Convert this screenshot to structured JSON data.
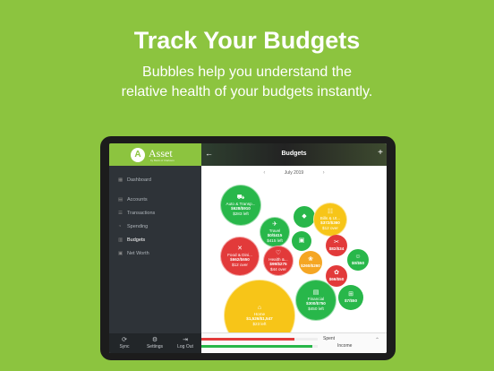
{
  "headline": "Track Your Budgets",
  "subline": [
    "Bubbles help you understand the",
    "relative health of your budgets instantly."
  ],
  "app": {
    "name": "Asset",
    "tagline": "by Bank of Clarkson",
    "logo_letter": "A"
  },
  "sidebar": {
    "items": [
      {
        "label": "Dashboard",
        "icon": "dashboard-icon"
      },
      {
        "label": "Accounts",
        "icon": "accounts-icon"
      },
      {
        "label": "Transactions",
        "icon": "transactions-icon"
      },
      {
        "label": "Spending",
        "icon": "spending-icon"
      },
      {
        "label": "Budgets",
        "icon": "budgets-icon",
        "active": true
      },
      {
        "label": "Net Worth",
        "icon": "net-worth-icon"
      }
    ],
    "footer": [
      {
        "label": "Sync",
        "icon": "sync-icon"
      },
      {
        "label": "Settings",
        "icon": "settings-icon"
      },
      {
        "label": "Log Out",
        "icon": "logout-icon"
      }
    ]
  },
  "topbar": {
    "title": "Budgets",
    "back": "←",
    "add": "+"
  },
  "period": {
    "month": "July 2019",
    "prev": "‹",
    "next": "›"
  },
  "bubbles": [
    {
      "name": "Auto & Transp...",
      "amount": "$628/$910",
      "status": "$283 left",
      "color": "green"
    },
    {
      "name": "Travel",
      "amount": "$0/$415",
      "status": "$415 left",
      "color": "green"
    },
    {
      "name": "",
      "amount": "",
      "status": "",
      "color": "green"
    },
    {
      "name": "Bills & Ut...",
      "amount": "$372/$360",
      "status": "$12 over",
      "color": "yellow"
    },
    {
      "name": "Food & Dini...",
      "amount": "$662/$650",
      "status": "$12 over",
      "color": "red"
    },
    {
      "name": "",
      "amount": "",
      "status": "",
      "color": "green"
    },
    {
      "name": "",
      "amount": "$82/$34",
      "status": "",
      "color": "red"
    },
    {
      "name": "Health &...",
      "amount": "$99/$275",
      "status": "$44 over",
      "color": "red"
    },
    {
      "name": "",
      "amount": "$260/$260",
      "status": "",
      "color": "orange"
    },
    {
      "name": "",
      "amount": "$0/$50",
      "status": "",
      "color": "green"
    },
    {
      "name": "",
      "amount": "$66/$50",
      "status": "",
      "color": "red"
    },
    {
      "name": "Home",
      "amount": "$1,526/$1,547",
      "status": "$23 left",
      "color": "yellow"
    },
    {
      "name": "Financial",
      "amount": "$300/$750",
      "status": "$450 left",
      "color": "green"
    },
    {
      "name": "",
      "amount": "$7/$50",
      "status": "",
      "color": "green"
    }
  ],
  "summary": {
    "spent_label": "Spent",
    "income_label": "Income",
    "spent_fraction": 0.8,
    "income_fraction": 0.95,
    "expand": "⌃"
  },
  "colors": {
    "background": "#8cc43f",
    "green": "#28b74a",
    "red": "#e23a3a",
    "orange": "#f5a623",
    "yellow": "#f7c518"
  }
}
